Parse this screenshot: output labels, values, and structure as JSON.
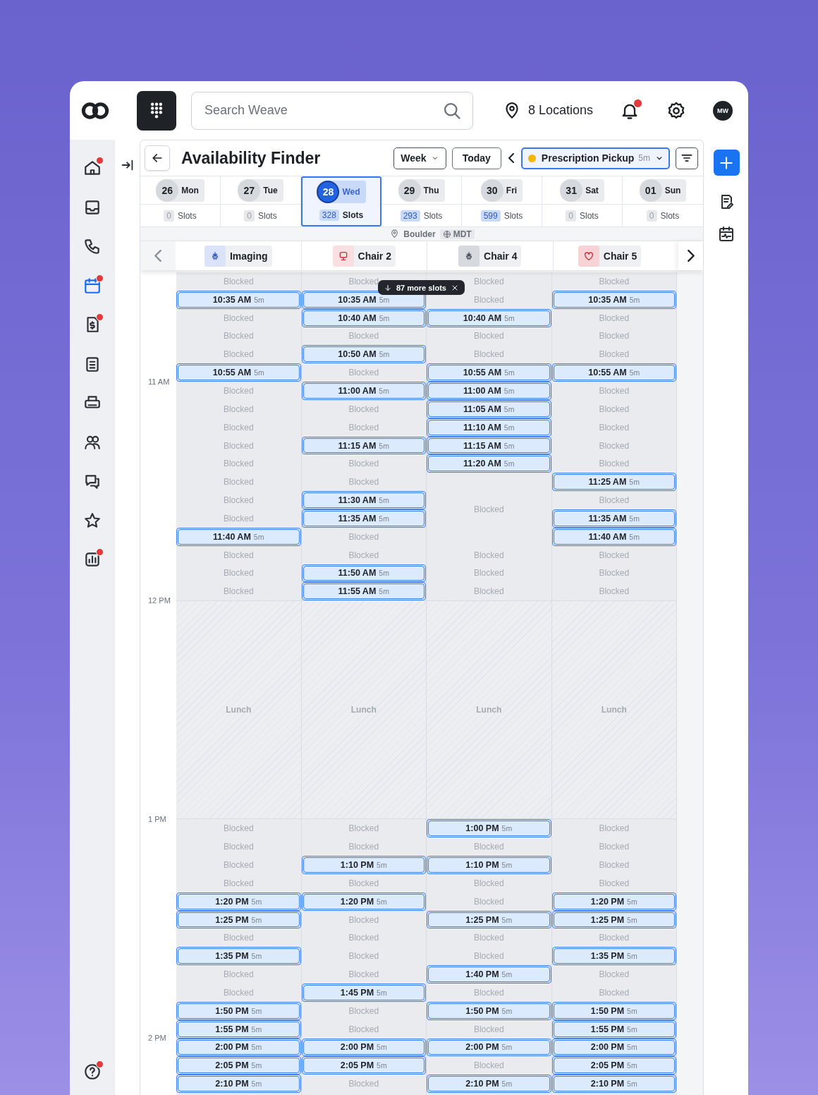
{
  "header": {
    "search": {
      "placeholder": "Search Weave"
    },
    "locations": "8 Locations",
    "notifications": {
      "unread": true
    },
    "avatar": "MW"
  },
  "sidebar": {
    "items": [
      {
        "selected": false,
        "badge": true
      },
      {
        "selected": false,
        "badge": false
      },
      {
        "selected": false,
        "badge": false
      },
      {
        "selected": true,
        "badge": true
      },
      {
        "selected": false,
        "badge": true
      },
      {
        "selected": false,
        "badge": false
      },
      {
        "selected": false,
        "badge": false
      },
      {
        "selected": false,
        "badge": false
      },
      {
        "selected": false,
        "badge": false
      },
      {
        "selected": false,
        "badge": false
      },
      {
        "selected": false,
        "badge": true
      }
    ],
    "help": {
      "badge": true
    }
  },
  "toolbar": {
    "title": "Availability Finder",
    "view": "Week",
    "today": "Today",
    "appointment_type": {
      "label": "Prescription Pickup",
      "duration": "5m",
      "color": "#f5b800"
    }
  },
  "days": [
    {
      "date": "26",
      "day": "Mon",
      "count": "0",
      "slots": "Slots",
      "available": false,
      "selected": false
    },
    {
      "date": "27",
      "day": "Tue",
      "count": "0",
      "slots": "Slots",
      "available": false,
      "selected": false
    },
    {
      "date": "28",
      "day": "Wed",
      "count": "328",
      "slots": "Slots",
      "available": true,
      "selected": true
    },
    {
      "date": "29",
      "day": "Thu",
      "count": "293",
      "slots": "Slots",
      "available": true,
      "selected": false
    },
    {
      "date": "30",
      "day": "Fri",
      "count": "599",
      "slots": "Slots",
      "available": true,
      "selected": false
    },
    {
      "date": "31",
      "day": "Sat",
      "count": "0",
      "slots": "Slots",
      "available": false,
      "selected": false
    },
    {
      "date": "01",
      "day": "Sun",
      "count": "0",
      "slots": "Slots",
      "available": false,
      "selected": false
    }
  ],
  "location": {
    "name": "Boulder",
    "timezone": "MDT"
  },
  "providers": [
    {
      "name": "Imaging",
      "color": "#dbe3fa"
    },
    {
      "name": "Chair 2",
      "color": "#fbdfe0"
    },
    {
      "name": "Chair 4",
      "color": "#d6d9de"
    },
    {
      "name": "Chair 5",
      "color": "#f8d3d5"
    }
  ],
  "hours": [
    "11 AM",
    "12 PM",
    "1 PM",
    "2 PM"
  ],
  "more_slots": {
    "label": "87 more slots"
  },
  "columns": [
    {
      "cells": [
        {
          "kind": "blocked",
          "label": "Blocked"
        },
        {
          "kind": "slot",
          "time": "10:35 AM",
          "duration": "5m"
        },
        {
          "kind": "blocked",
          "label": "Blocked"
        },
        {
          "kind": "blocked",
          "label": "Blocked"
        },
        {
          "kind": "blocked",
          "label": "Blocked"
        },
        {
          "kind": "slot",
          "time": "10:55 AM",
          "duration": "5m"
        },
        {
          "kind": "blocked",
          "label": "Blocked"
        },
        {
          "kind": "blocked",
          "label": "Blocked"
        },
        {
          "kind": "blocked",
          "label": "Blocked"
        },
        {
          "kind": "blocked",
          "label": "Blocked"
        },
        {
          "kind": "blocked",
          "label": "Blocked"
        },
        {
          "kind": "blocked",
          "label": "Blocked"
        },
        {
          "kind": "blocked",
          "label": "Blocked"
        },
        {
          "kind": "blocked",
          "label": "Blocked"
        },
        {
          "kind": "slot",
          "time": "11:40 AM",
          "duration": "5m"
        },
        {
          "kind": "blocked",
          "label": "Blocked"
        },
        {
          "kind": "blocked",
          "label": "Blocked"
        },
        {
          "kind": "blocked",
          "label": "Blocked"
        },
        {
          "kind": "lunch",
          "label": "Lunch"
        },
        {
          "kind": "blocked",
          "label": "Blocked"
        },
        {
          "kind": "blocked",
          "label": "Blocked"
        },
        {
          "kind": "blocked",
          "label": "Blocked"
        },
        {
          "kind": "blocked",
          "label": "Blocked"
        },
        {
          "kind": "slot",
          "time": "1:20 PM",
          "duration": "5m"
        },
        {
          "kind": "slot",
          "time": "1:25 PM",
          "duration": "5m"
        },
        {
          "kind": "blocked",
          "label": "Blocked"
        },
        {
          "kind": "slot",
          "time": "1:35 PM",
          "duration": "5m"
        },
        {
          "kind": "blocked",
          "label": "Blocked"
        },
        {
          "kind": "blocked",
          "label": "Blocked"
        },
        {
          "kind": "slot",
          "time": "1:50 PM",
          "duration": "5m"
        },
        {
          "kind": "slot",
          "time": "1:55 PM",
          "duration": "5m"
        },
        {
          "kind": "slot",
          "time": "2:00 PM",
          "duration": "5m"
        },
        {
          "kind": "slot",
          "time": "2:05 PM",
          "duration": "5m"
        },
        {
          "kind": "slot",
          "time": "2:10 PM",
          "duration": "5m"
        }
      ]
    },
    {
      "cells": [
        {
          "kind": "blocked",
          "label": "Blocked"
        },
        {
          "kind": "slot",
          "time": "10:35 AM",
          "duration": "5m"
        },
        {
          "kind": "slot",
          "time": "10:40 AM",
          "duration": "5m"
        },
        {
          "kind": "blocked",
          "label": "Blocked"
        },
        {
          "kind": "slot",
          "time": "10:50 AM",
          "duration": "5m"
        },
        {
          "kind": "blocked",
          "label": "Blocked"
        },
        {
          "kind": "slot",
          "time": "11:00 AM",
          "duration": "5m"
        },
        {
          "kind": "blocked",
          "label": "Blocked"
        },
        {
          "kind": "blocked",
          "label": "Blocked"
        },
        {
          "kind": "slot",
          "time": "11:15 AM",
          "duration": "5m"
        },
        {
          "kind": "blocked",
          "label": "Blocked"
        },
        {
          "kind": "blocked",
          "label": "Blocked"
        },
        {
          "kind": "slot",
          "time": "11:30 AM",
          "duration": "5m"
        },
        {
          "kind": "slot",
          "time": "11:35 AM",
          "duration": "5m"
        },
        {
          "kind": "blocked",
          "label": "Blocked"
        },
        {
          "kind": "blocked",
          "label": "Blocked"
        },
        {
          "kind": "slot",
          "time": "11:50 AM",
          "duration": "5m"
        },
        {
          "kind": "slot",
          "time": "11:55 AM",
          "duration": "5m"
        },
        {
          "kind": "lunch",
          "label": "Lunch"
        },
        {
          "kind": "blocked",
          "label": "Blocked"
        },
        {
          "kind": "blocked",
          "label": "Blocked"
        },
        {
          "kind": "slot",
          "time": "1:10 PM",
          "duration": "5m"
        },
        {
          "kind": "blocked",
          "label": "Blocked"
        },
        {
          "kind": "slot",
          "time": "1:20 PM",
          "duration": "5m"
        },
        {
          "kind": "blocked",
          "label": "Blocked"
        },
        {
          "kind": "blocked",
          "label": "Blocked"
        },
        {
          "kind": "blocked",
          "label": "Blocked"
        },
        {
          "kind": "blocked",
          "label": "Blocked"
        },
        {
          "kind": "slot",
          "time": "1:45 PM",
          "duration": "5m"
        },
        {
          "kind": "blocked",
          "label": "Blocked"
        },
        {
          "kind": "blocked",
          "label": "Blocked"
        },
        {
          "kind": "slot",
          "time": "2:00 PM",
          "duration": "5m"
        },
        {
          "kind": "slot",
          "time": "2:05 PM",
          "duration": "5m"
        },
        {
          "kind": "blocked",
          "label": "Blocked"
        }
      ]
    },
    {
      "cells": [
        {
          "kind": "blocked",
          "label": "Blocked"
        },
        {
          "kind": "blocked",
          "label": "Blocked"
        },
        {
          "kind": "slot",
          "time": "10:40 AM",
          "duration": "5m"
        },
        {
          "kind": "blocked",
          "label": "Blocked"
        },
        {
          "kind": "blocked",
          "label": "Blocked"
        },
        {
          "kind": "slot",
          "time": "10:55 AM",
          "duration": "5m"
        },
        {
          "kind": "slot",
          "time": "11:00 AM",
          "duration": "5m"
        },
        {
          "kind": "slot",
          "time": "11:05 AM",
          "duration": "5m"
        },
        {
          "kind": "slot",
          "time": "11:10 AM",
          "duration": "5m"
        },
        {
          "kind": "slot",
          "time": "11:15 AM",
          "duration": "5m"
        },
        {
          "kind": "slot",
          "time": "11:20 AM",
          "duration": "5m"
        },
        {
          "kind": "blocked_long",
          "label": "Blocked"
        },
        {
          "kind": "blocked",
          "label": "Blocked"
        },
        {
          "kind": "blocked",
          "label": "Blocked"
        },
        {
          "kind": "blocked",
          "label": "Blocked"
        },
        {
          "kind": "lunch",
          "label": "Lunch"
        },
        {
          "kind": "slot",
          "time": "1:00 PM",
          "duration": "5m"
        },
        {
          "kind": "blocked",
          "label": "Blocked"
        },
        {
          "kind": "slot",
          "time": "1:10 PM",
          "duration": "5m"
        },
        {
          "kind": "blocked",
          "label": "Blocked"
        },
        {
          "kind": "blocked",
          "label": "Blocked"
        },
        {
          "kind": "slot",
          "time": "1:25 PM",
          "duration": "5m"
        },
        {
          "kind": "blocked",
          "label": "Blocked"
        },
        {
          "kind": "blocked",
          "label": "Blocked"
        },
        {
          "kind": "slot",
          "time": "1:40 PM",
          "duration": "5m"
        },
        {
          "kind": "blocked",
          "label": "Blocked"
        },
        {
          "kind": "slot",
          "time": "1:50 PM",
          "duration": "5m"
        },
        {
          "kind": "blocked",
          "label": "Blocked"
        },
        {
          "kind": "slot",
          "time": "2:00 PM",
          "duration": "5m"
        },
        {
          "kind": "blocked",
          "label": "Blocked"
        },
        {
          "kind": "slot",
          "time": "2:10 PM",
          "duration": "5m"
        }
      ]
    },
    {
      "cells": [
        {
          "kind": "blocked",
          "label": "Blocked"
        },
        {
          "kind": "slot",
          "time": "10:35 AM",
          "duration": "5m"
        },
        {
          "kind": "blocked",
          "label": "Blocked"
        },
        {
          "kind": "blocked",
          "label": "Blocked"
        },
        {
          "kind": "blocked",
          "label": "Blocked"
        },
        {
          "kind": "slot",
          "time": "10:55 AM",
          "duration": "5m"
        },
        {
          "kind": "blocked",
          "label": "Blocked"
        },
        {
          "kind": "blocked",
          "label": "Blocked"
        },
        {
          "kind": "blocked",
          "label": "Blocked"
        },
        {
          "kind": "blocked",
          "label": "Blocked"
        },
        {
          "kind": "blocked",
          "label": "Blocked"
        },
        {
          "kind": "slot",
          "time": "11:25 AM",
          "duration": "5m"
        },
        {
          "kind": "blocked",
          "label": "Blocked"
        },
        {
          "kind": "slot",
          "time": "11:35 AM",
          "duration": "5m"
        },
        {
          "kind": "slot",
          "time": "11:40 AM",
          "duration": "5m"
        },
        {
          "kind": "blocked",
          "label": "Blocked"
        },
        {
          "kind": "blocked",
          "label": "Blocked"
        },
        {
          "kind": "blocked",
          "label": "Blocked"
        },
        {
          "kind": "lunch",
          "label": "Lunch"
        },
        {
          "kind": "blocked",
          "label": "Blocked"
        },
        {
          "kind": "blocked",
          "label": "Blocked"
        },
        {
          "kind": "blocked",
          "label": "Blocked"
        },
        {
          "kind": "blocked",
          "label": "Blocked"
        },
        {
          "kind": "slot",
          "time": "1:20 PM",
          "duration": "5m"
        },
        {
          "kind": "slot",
          "time": "1:25 PM",
          "duration": "5m"
        },
        {
          "kind": "blocked",
          "label": "Blocked"
        },
        {
          "kind": "slot",
          "time": "1:35 PM",
          "duration": "5m"
        },
        {
          "kind": "blocked",
          "label": "Blocked"
        },
        {
          "kind": "blocked",
          "label": "Blocked"
        },
        {
          "kind": "slot",
          "time": "1:50 PM",
          "duration": "5m"
        },
        {
          "kind": "slot",
          "time": "1:55 PM",
          "duration": "5m"
        },
        {
          "kind": "slot",
          "time": "2:00 PM",
          "duration": "5m"
        },
        {
          "kind": "slot",
          "time": "2:05 PM",
          "duration": "5m"
        },
        {
          "kind": "slot",
          "time": "2:10 PM",
          "duration": "5m"
        }
      ]
    }
  ]
}
